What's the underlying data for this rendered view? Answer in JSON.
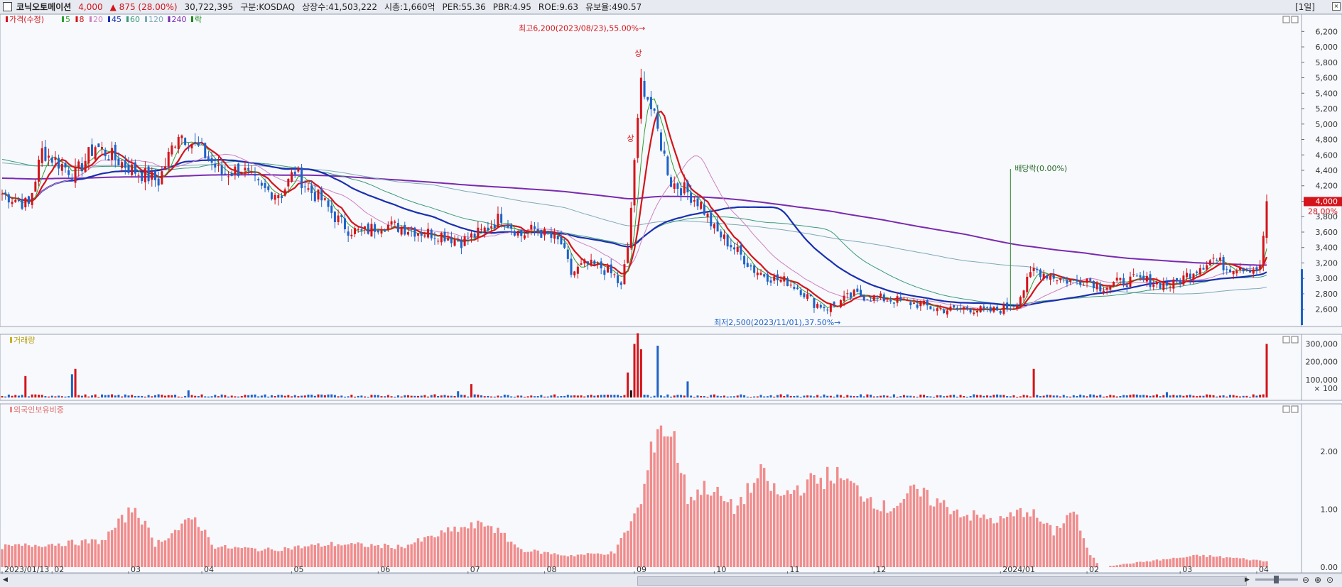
{
  "header": {
    "name": "코닉오토메이션",
    "price": "4,000",
    "change": "▲ 875 (28.00%)",
    "volume": "30,722,395",
    "market": "구분:KOSDAQ",
    "shares": "상장수:41,503,222",
    "mcap": "시총:1,660억",
    "per": "PER:55.36",
    "pbr": "PBR:4.95",
    "roe": "ROE:9.63",
    "reserve": "유보율:490.57",
    "period": "[1일]"
  },
  "colors": {
    "up": "#d4141a",
    "down": "#1e62c8",
    "ma5": "#2e9e2e",
    "ma8": "#d4141a",
    "ma20": "#d080c0",
    "ma45": "#1a2fb0",
    "ma60": "#3a9a7a",
    "ma120": "#7ea8b8",
    "ma240": "#7a2ab0"
  },
  "chart_data": [
    {
      "type": "candlestick",
      "title": "",
      "legend": [
        "가격(수정)",
        "5",
        "8",
        "20",
        "45",
        "60",
        "120",
        "240",
        "락"
      ],
      "y_ticks": [
        "6,200",
        "6,000",
        "5,800",
        "5,600",
        "5,400",
        "5,200",
        "5,000",
        "4,800",
        "4,600",
        "4,400",
        "4,200",
        "4,000",
        "3,800",
        "3,600",
        "3,400",
        "3,200",
        "3,000",
        "2,800",
        "2,600"
      ],
      "ylim": [
        2450,
        6350
      ],
      "x_ticks": [
        "2023/01/13",
        "02",
        "03",
        "04",
        "05",
        "06",
        "07",
        "08",
        "09",
        "10",
        "11",
        "12",
        "2024/01",
        "02",
        "03",
        "04"
      ],
      "annotations": {
        "high": "최고6,200(2023/08/23),55.00%",
        "low": "최저2,500(2023/11/01),37.50%",
        "ex_div": "배당락(0.00%)",
        "limit_up": "상"
      },
      "last_price_label": "4,000",
      "last_change_label": "28.00%",
      "price_path": [
        [
          0,
          4100
        ],
        [
          8,
          3950
        ],
        [
          12,
          4650
        ],
        [
          22,
          4350
        ],
        [
          28,
          4720
        ],
        [
          34,
          4550
        ],
        [
          40,
          4390
        ],
        [
          47,
          4260
        ],
        [
          53,
          4900
        ],
        [
          60,
          4650
        ],
        [
          66,
          4350
        ],
        [
          72,
          4420
        ],
        [
          78,
          4150
        ],
        [
          84,
          4100
        ],
        [
          88,
          4400
        ],
        [
          92,
          4150
        ],
        [
          96,
          4020
        ],
        [
          100,
          3800
        ],
        [
          104,
          3640
        ],
        [
          108,
          3590
        ],
        [
          114,
          3700
        ],
        [
          120,
          3660
        ],
        [
          126,
          3600
        ],
        [
          132,
          3570
        ],
        [
          138,
          3480
        ],
        [
          144,
          3600
        ],
        [
          150,
          3800
        ],
        [
          156,
          3560
        ],
        [
          160,
          3640
        ],
        [
          164,
          3550
        ],
        [
          168,
          3450
        ],
        [
          171,
          3060
        ],
        [
          175,
          3180
        ],
        [
          180,
          3140
        ],
        [
          184,
          3030
        ],
        [
          186,
          2880
        ],
        [
          188,
          3400
        ],
        [
          190,
          4450
        ],
        [
          192,
          5600
        ],
        [
          194,
          5350
        ],
        [
          197,
          4900
        ],
        [
          201,
          4250
        ],
        [
          205,
          4150
        ],
        [
          210,
          3960
        ],
        [
          214,
          3630
        ],
        [
          220,
          3390
        ],
        [
          226,
          3110
        ],
        [
          232,
          2990
        ],
        [
          236,
          2960
        ],
        [
          240,
          2850
        ],
        [
          244,
          2680
        ],
        [
          248,
          2620
        ],
        [
          252,
          2700
        ],
        [
          256,
          2790
        ],
        [
          262,
          2750
        ],
        [
          268,
          2720
        ],
        [
          272,
          2690
        ],
        [
          276,
          2660
        ],
        [
          280,
          2610
        ],
        [
          286,
          2590
        ],
        [
          290,
          2620
        ],
        [
          296,
          2570
        ],
        [
          300,
          2600
        ],
        [
          304,
          2640
        ],
        [
          306,
          2780
        ],
        [
          310,
          3120
        ],
        [
          314,
          3050
        ],
        [
          318,
          3000
        ],
        [
          322,
          2950
        ],
        [
          326,
          3000
        ],
        [
          330,
          2890
        ],
        [
          336,
          2950
        ],
        [
          340,
          2980
        ],
        [
          344,
          2970
        ],
        [
          348,
          2930
        ],
        [
          352,
          2920
        ],
        [
          356,
          3040
        ],
        [
          360,
          3160
        ],
        [
          364,
          3260
        ],
        [
          368,
          3140
        ],
        [
          372,
          3160
        ],
        [
          376,
          3130
        ],
        [
          378,
          3120
        ],
        [
          380,
          4000
        ]
      ],
      "ma_last": {
        "ma5": 3180,
        "ma8": 3160,
        "ma20": 3090,
        "ma45": 2990,
        "ma60": 2930,
        "ma120": 2880,
        "ma240": 3250
      }
    },
    {
      "type": "bar",
      "title": "거래량",
      "y_ticks": [
        "300,000",
        "200,000",
        "100,000",
        "× 100"
      ],
      "ylim": [
        0,
        330000
      ],
      "notable_bars": [
        [
          7,
          120000
        ],
        [
          21,
          130000
        ],
        [
          22,
          160000
        ],
        [
          56,
          40000
        ],
        [
          137,
          35000
        ],
        [
          141,
          75000
        ],
        [
          188,
          140000
        ],
        [
          189,
          40000
        ],
        [
          190,
          300000
        ],
        [
          191,
          360000
        ],
        [
          192,
          270000
        ],
        [
          197,
          290000
        ],
        [
          206,
          90000
        ],
        [
          310,
          160000
        ],
        [
          350,
          30000
        ],
        [
          380,
          300000
        ]
      ]
    },
    {
      "type": "bar",
      "title": "외국인보유비중",
      "y_ticks": [
        "2.00",
        "1.00",
        "0.00"
      ],
      "ylim": [
        0,
        2.6
      ],
      "segments": [
        [
          0,
          0.35
        ],
        [
          30,
          0.45
        ],
        [
          40,
          1.05
        ],
        [
          46,
          0.4
        ],
        [
          58,
          0.85
        ],
        [
          64,
          0.35
        ],
        [
          80,
          0.3
        ],
        [
          100,
          0.4
        ],
        [
          120,
          0.35
        ],
        [
          136,
          0.65
        ],
        [
          146,
          0.75
        ],
        [
          156,
          0.3
        ],
        [
          170,
          0.2
        ],
        [
          184,
          0.25
        ],
        [
          192,
          1.1
        ],
        [
          197,
          2.5
        ],
        [
          202,
          2.2
        ],
        [
          206,
          1.2
        ],
        [
          212,
          1.4
        ],
        [
          220,
          1.0
        ],
        [
          228,
          1.6
        ],
        [
          234,
          1.2
        ],
        [
          240,
          1.4
        ],
        [
          250,
          1.6
        ],
        [
          258,
          1.3
        ],
        [
          266,
          1.0
        ],
        [
          274,
          1.3
        ],
        [
          282,
          1.1
        ],
        [
          290,
          0.9
        ],
        [
          300,
          0.8
        ],
        [
          308,
          1.0
        ],
        [
          316,
          0.6
        ],
        [
          322,
          1.0
        ],
        [
          326,
          0.3
        ],
        [
          330,
          0.0
        ],
        [
          344,
          0.1
        ],
        [
          360,
          0.2
        ],
        [
          372,
          0.15
        ],
        [
          380,
          0.1
        ]
      ]
    }
  ]
}
